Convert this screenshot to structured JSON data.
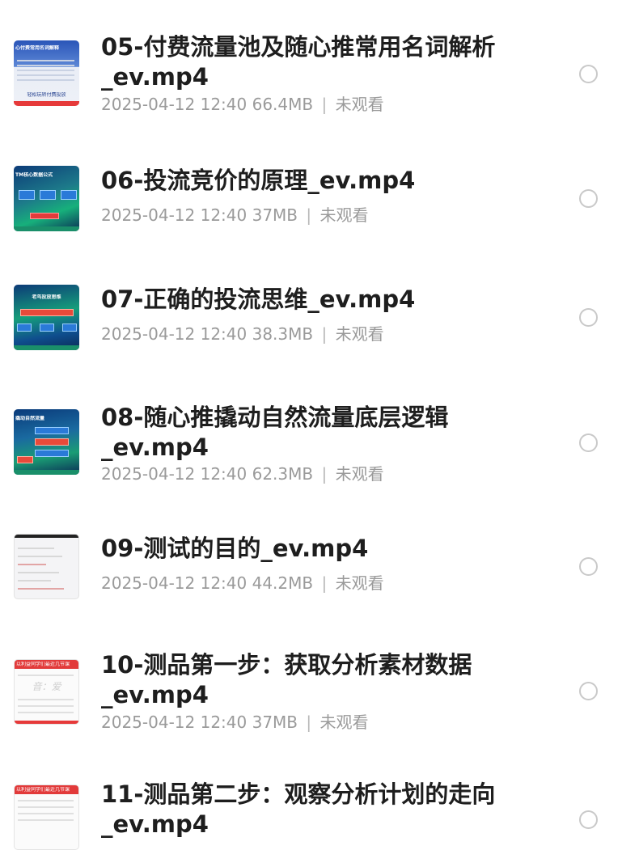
{
  "items": [
    {
      "title": "05-付费流量池及随心推常用名词解析_ev.mp4",
      "date": "2025-04-12 12:40",
      "size": "66.4MB",
      "status": "未观看",
      "thumb_text": "心付费常用名词解释",
      "thumb_caption": "轻松玩转付费投放"
    },
    {
      "title": "06-投流竞价的原理_ev.mp4",
      "date": "2025-04-12 12:40",
      "size": "37MB",
      "status": "未观看",
      "thumb_text": "TM核心数据公式"
    },
    {
      "title": "07-正确的投流思维_ev.mp4",
      "date": "2025-04-12 12:40",
      "size": "38.3MB",
      "status": "未观看",
      "thumb_text": "老鸟投放思维"
    },
    {
      "title": "08-随心推撬动自然流量底层逻辑_ev.mp4",
      "date": "2025-04-12 12:40",
      "size": "62.3MB",
      "status": "未观看",
      "thumb_text": "撬动自然流量"
    },
    {
      "title": "09-测试的目的_ev.mp4",
      "date": "2025-04-12 12:40",
      "size": "44.2MB",
      "status": "未观看",
      "thumb_text": ""
    },
    {
      "title": "10-测品第一步：获取分析素材数据_ev.mp4",
      "date": "2025-04-12 12:40",
      "size": "37MB",
      "status": "未观看",
      "thumb_text": "以利益同学们最近几节课",
      "thumb_watermark": "音：爱"
    },
    {
      "title": "11-测品第二步：观察分析计划的走向_ev.mp4",
      "date": "",
      "size": "",
      "status": "",
      "thumb_text": "以利益同学们最近几节课"
    }
  ],
  "separator": "|",
  "colors": {
    "title": "#1e1e1e",
    "meta": "#9a9a9a",
    "radio_border": "#c9c9c9"
  }
}
